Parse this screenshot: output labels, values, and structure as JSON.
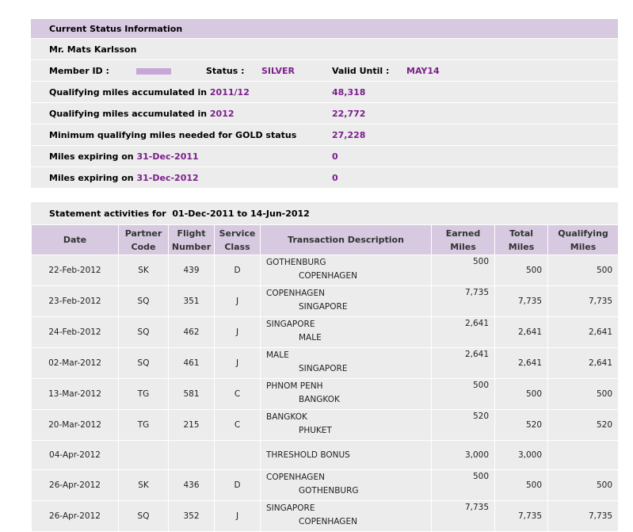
{
  "status_info": {
    "header": "Current Status Information",
    "name": "Mr. Mats Karlsson",
    "member_id_label": "Member ID :",
    "status_label": "Status :",
    "status_value": "SILVER",
    "valid_until_label": "Valid Until :",
    "valid_until_value": "MAY14",
    "qual_2011_label": "Qualifying miles accumulated in",
    "qual_2011_year": "2011/12",
    "qual_2011_value": "48,318",
    "qual_2012_label": "Qualifying miles accumulated in",
    "qual_2012_year": "2012",
    "qual_2012_value": "22,772",
    "min_gold_label": "Minimum qualifying miles needed for GOLD status",
    "min_gold_value": "27,228",
    "expire1_label": "Miles expiring on",
    "expire1_date": "31-Dec-2011",
    "expire1_value": "0",
    "expire2_label": "Miles expiring on",
    "expire2_date": "31-Dec-2012",
    "expire2_value": "0"
  },
  "statement": {
    "label": "Statement activities for",
    "period": "01-Dec-2011 to 14-Jun-2012",
    "columns": [
      "Date",
      "Partner Code",
      "Flight Number",
      "Service Class",
      "Transaction Description",
      "Earned Miles",
      "Total Miles",
      "Qualifying Miles"
    ],
    "rows": [
      {
        "date": "22-Feb-2012",
        "partner": "SK",
        "flight": "439",
        "cls": "D",
        "from": "GOTHENBURG",
        "to": "COPENHAGEN",
        "earned": "500",
        "total": "500",
        "qualifying": "500"
      },
      {
        "date": "23-Feb-2012",
        "partner": "SQ",
        "flight": "351",
        "cls": "J",
        "from": "COPENHAGEN",
        "to": "SINGAPORE",
        "earned": "7,735",
        "total": "7,735",
        "qualifying": "7,735"
      },
      {
        "date": "24-Feb-2012",
        "partner": "SQ",
        "flight": "462",
        "cls": "J",
        "from": "SINGAPORE",
        "to": "MALE",
        "earned": "2,641",
        "total": "2,641",
        "qualifying": "2,641"
      },
      {
        "date": "02-Mar-2012",
        "partner": "SQ",
        "flight": "461",
        "cls": "J",
        "from": "MALE",
        "to": "SINGAPORE",
        "earned": "2,641",
        "total": "2,641",
        "qualifying": "2,641"
      },
      {
        "date": "13-Mar-2012",
        "partner": "TG",
        "flight": "581",
        "cls": "C",
        "from": "PHNOM PENH",
        "to": "BANGKOK",
        "earned": "500",
        "total": "500",
        "qualifying": "500"
      },
      {
        "date": "20-Mar-2012",
        "partner": "TG",
        "flight": "215",
        "cls": "C",
        "from": "BANGKOK",
        "to": "PHUKET",
        "earned": "520",
        "total": "520",
        "qualifying": "520"
      },
      {
        "date": "04-Apr-2012",
        "partner": "",
        "flight": "",
        "cls": "",
        "from": "THRESHOLD BONUS",
        "to": "",
        "earned": "3,000",
        "total": "3,000",
        "qualifying": ""
      },
      {
        "date": "26-Apr-2012",
        "partner": "SK",
        "flight": "436",
        "cls": "D",
        "from": "COPENHAGEN",
        "to": "GOTHENBURG",
        "earned": "500",
        "total": "500",
        "qualifying": "500"
      },
      {
        "date": "26-Apr-2012",
        "partner": "SQ",
        "flight": "352",
        "cls": "J",
        "from": "SINGAPORE",
        "to": "COPENHAGEN",
        "earned": "7,735",
        "total": "7,735",
        "qualifying": "7,735"
      }
    ]
  },
  "colors": {
    "accent": "#7b1f8c",
    "header_bg": "#d6c9e0",
    "row_bg": "#ececec",
    "masked_id": "#c8a6d8"
  }
}
